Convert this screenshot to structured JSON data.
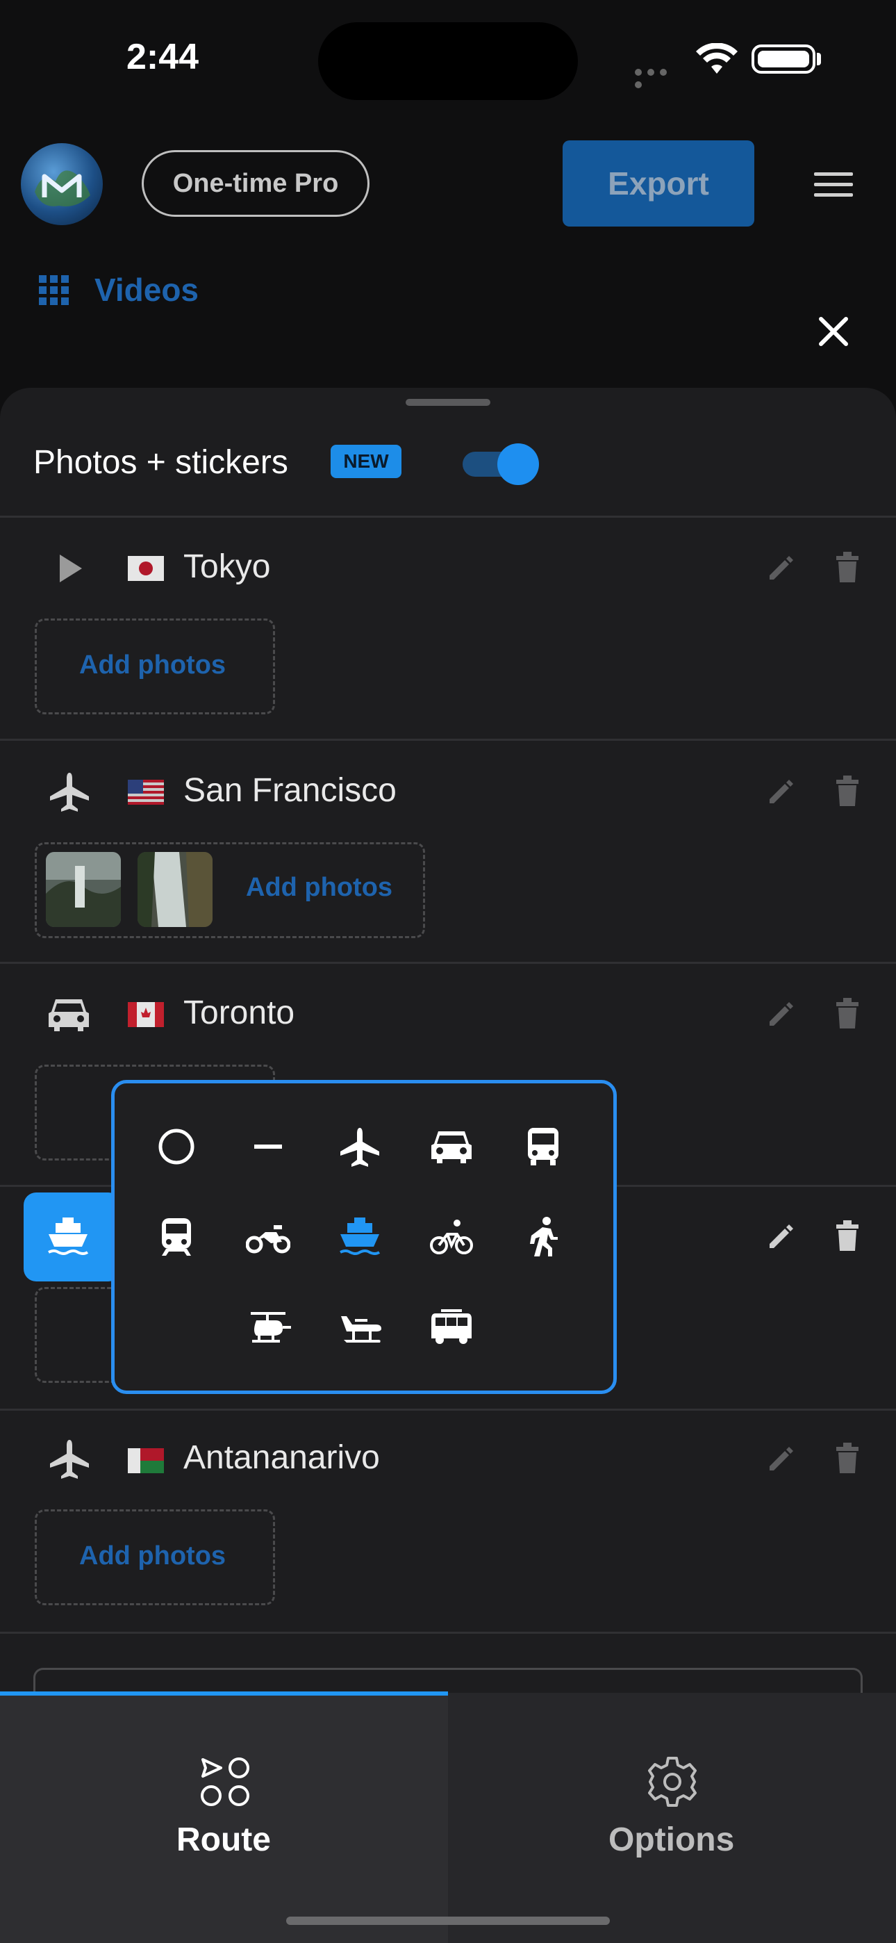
{
  "status_bar": {
    "time": "2:44"
  },
  "header": {
    "pro_label": "One-time Pro",
    "export_label": "Export",
    "videos_label": "Videos"
  },
  "sheet": {
    "photos_stickers_label": "Photos + stickers",
    "new_badge": "NEW",
    "toggle_on": true,
    "add_photos_label": "Add photos",
    "stops": [
      {
        "transport": "play-icon",
        "flag": "Japan",
        "city": "Tokyo"
      },
      {
        "transport": "airplane-icon",
        "flag": "United States",
        "city": "San Francisco"
      },
      {
        "transport": "car-icon",
        "flag": "Canada",
        "city": "Toronto"
      },
      {
        "transport": "boat-icon",
        "flag": "",
        "city": ""
      },
      {
        "transport": "airplane-icon",
        "flag": "Madagascar",
        "city": "Antananarivo"
      }
    ]
  },
  "transport_picker": {
    "options": [
      "none-circle-icon",
      "line-icon",
      "airplane-icon",
      "car-icon",
      "bus-icon",
      "train-icon",
      "motorcycle-icon",
      "boat-icon",
      "bicycle-icon",
      "walking-icon",
      "helicopter-icon",
      "seaplane-icon",
      "van-icon"
    ],
    "selected": "boat-icon",
    "accent_color": "#2196f3"
  },
  "tabs": [
    {
      "label": "Route",
      "active": true
    },
    {
      "label": "Options",
      "active": false
    }
  ],
  "colors": {
    "accent": "#2196f3",
    "link": "#1e63ad"
  }
}
